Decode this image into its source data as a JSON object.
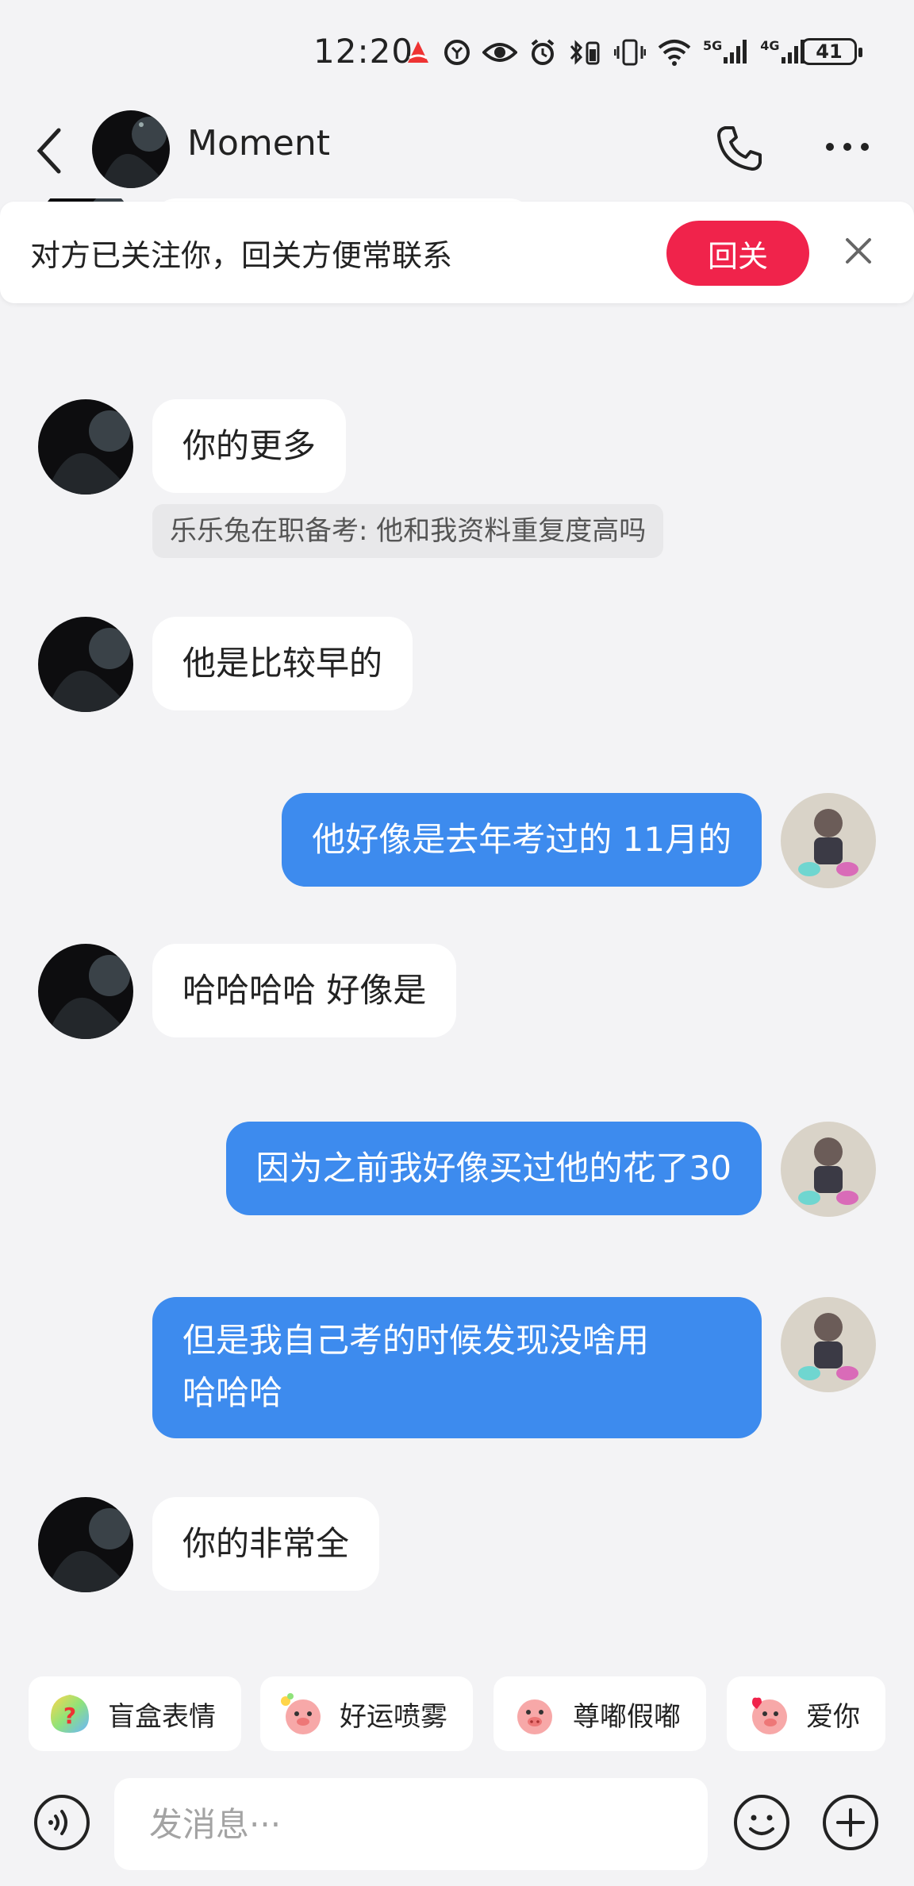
{
  "status_bar": {
    "time": "12:20",
    "net1": "5G",
    "net2": "4G",
    "battery": "41"
  },
  "header": {
    "contact_name": "Moment"
  },
  "banner": {
    "text": "对方已关注你，回关方便常联系",
    "follow_label": "回关"
  },
  "messages": [
    {
      "dir": "in",
      "text": "你的更多"
    },
    {
      "dir": "quote",
      "text": "乐乐兔在职备考: 他和我资料重复度高吗"
    },
    {
      "dir": "in",
      "text": "他是比较早的"
    },
    {
      "dir": "out",
      "text": "他好像是去年考过的 11月的"
    },
    {
      "dir": "in",
      "text": "哈哈哈哈 好像是"
    },
    {
      "dir": "out",
      "text": "因为之前我好像买过他的花了30"
    },
    {
      "dir": "out",
      "line1": "但是我自己考的时候发现没啥用",
      "line2": "哈哈哈"
    },
    {
      "dir": "in",
      "text": "你的非常全"
    }
  ],
  "quick_reactions": [
    "盲盒表情",
    "好运喷雾",
    "尊嘟假嘟",
    "爱你"
  ],
  "input": {
    "placeholder": "发消息···"
  },
  "colors": {
    "accent_blue": "#3d8bee",
    "follow_red": "#f0234b",
    "background": "#f3f3f5"
  }
}
